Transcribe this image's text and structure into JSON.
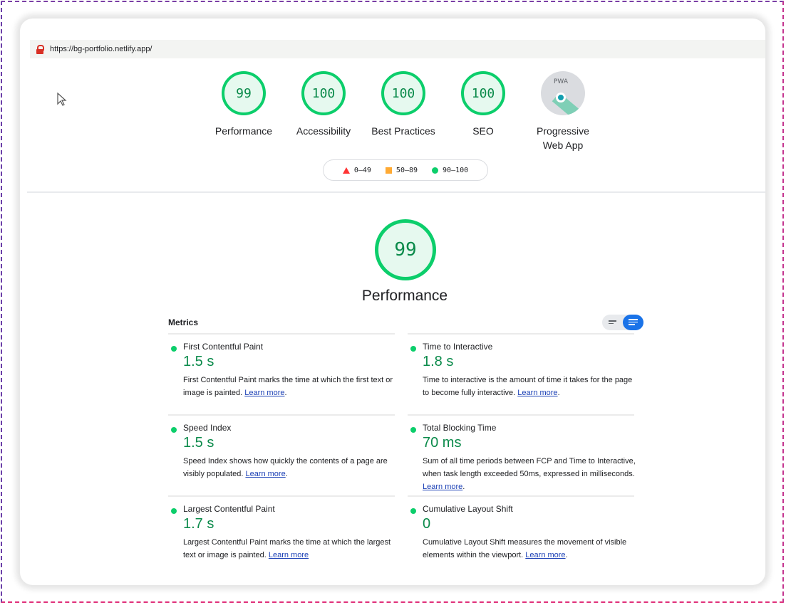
{
  "browser": {
    "url": "https://bg-portfolio.netlify.app/"
  },
  "categories": [
    {
      "label": "Performance",
      "score": "99"
    },
    {
      "label": "Accessibility",
      "score": "100"
    },
    {
      "label": "Best Practices",
      "score": "100"
    },
    {
      "label": "SEO",
      "score": "100"
    }
  ],
  "pwa": {
    "label_line1": "Progressive",
    "label_line2": "Web App",
    "badge_text": "PWA"
  },
  "legend": {
    "fail": "0–49",
    "average": "50–89",
    "pass": "90–100"
  },
  "summary": {
    "score": "99",
    "title": "Performance"
  },
  "metrics_title": "Metrics",
  "learn_more": "Learn more",
  "metrics_left": [
    {
      "name": "First Contentful Paint",
      "value": "1.5 s",
      "desc": "First Contentful Paint marks the time at which the first text or image is painted.",
      "suffix": "."
    },
    {
      "name": "Speed Index",
      "value": "1.5 s",
      "desc": "Speed Index shows how quickly the contents of a page are visibly populated.",
      "suffix": "."
    },
    {
      "name": "Largest Contentful Paint",
      "value": "1.7 s",
      "desc": "Largest Contentful Paint marks the time at which the largest text or image is painted.",
      "suffix": ""
    }
  ],
  "metrics_right": [
    {
      "name": "Time to Interactive",
      "value": "1.8 s",
      "desc": "Time to interactive is the amount of time it takes for the page to become fully interactive.",
      "suffix": "."
    },
    {
      "name": "Total Blocking Time",
      "value": "70 ms",
      "desc": "Sum of all time periods between FCP and Time to Interactive, when task length exceeded 50ms, expressed in milliseconds.",
      "suffix": "."
    },
    {
      "name": "Cumulative Layout Shift",
      "value": "0",
      "desc": "Cumulative Layout Shift measures the movement of visible elements within the viewport.",
      "suffix": "."
    }
  ],
  "colors": {
    "pass": "#0cce6b",
    "average": "#ffaa33",
    "fail": "#ff3333",
    "link": "#1a3fb5",
    "toggle_active": "#1a73e8"
  }
}
